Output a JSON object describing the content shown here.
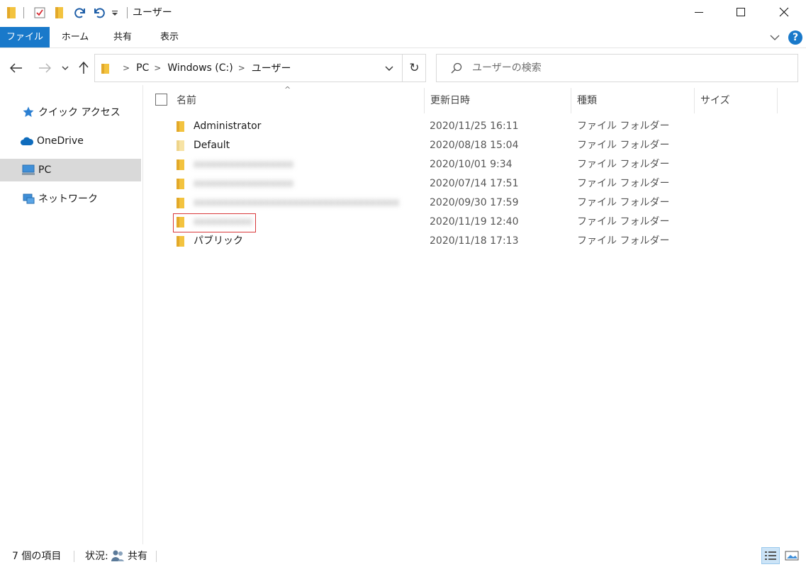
{
  "window": {
    "title": "ユーザー"
  },
  "ribbon": {
    "tabs": [
      {
        "label": "ファイル"
      },
      {
        "label": "ホーム"
      },
      {
        "label": "共有"
      },
      {
        "label": "表示"
      }
    ],
    "help_label": "?"
  },
  "nav": {
    "breadcrumbs": [
      {
        "label": "PC"
      },
      {
        "label": "Windows (C:)"
      },
      {
        "label": "ユーザー"
      }
    ],
    "search_placeholder": "ユーザーの検索"
  },
  "sidebar": {
    "items": [
      {
        "label": "クイック アクセス",
        "icon": "star-icon"
      },
      {
        "label": "OneDrive",
        "icon": "cloud-icon"
      },
      {
        "label": "PC",
        "icon": "computer-icon",
        "selected": true
      },
      {
        "label": "ネットワーク",
        "icon": "network-icon"
      }
    ]
  },
  "file_list": {
    "columns": [
      {
        "label": "名前"
      },
      {
        "label": "更新日時"
      },
      {
        "label": "種類"
      },
      {
        "label": "サイズ"
      }
    ],
    "sort_indicator": "^",
    "rows": [
      {
        "name": "Administrator",
        "date": "2020/11/25 16:11",
        "type": "ファイル フォルダー",
        "blurred": false
      },
      {
        "name": "Default",
        "date": "2020/08/18 15:04",
        "type": "ファイル フォルダー",
        "blurred": false
      },
      {
        "name": "",
        "date": "2020/10/01 9:34",
        "type": "ファイル フォルダー",
        "blurred": true
      },
      {
        "name": "",
        "date": "2020/07/14 17:51",
        "type": "ファイル フォルダー",
        "blurred": true
      },
      {
        "name": "",
        "date": "2020/09/30 17:59",
        "type": "ファイル フォルダー",
        "blurred": true
      },
      {
        "name": "",
        "date": "2020/11/19 12:40",
        "type": "ファイル フォルダー",
        "blurred": true,
        "highlighted": true
      },
      {
        "name": "パブリック",
        "date": "2020/11/18 17:13",
        "type": "ファイル フォルダー",
        "blurred": false
      }
    ]
  },
  "status": {
    "item_count": "7 個の項目",
    "state_label": "状況:",
    "state_value": "共有"
  },
  "colors": {
    "accent": "#1979ca",
    "folder": "#f3c33f",
    "highlight_border": "#d9383a",
    "selected_bg": "#d9d9d9"
  }
}
